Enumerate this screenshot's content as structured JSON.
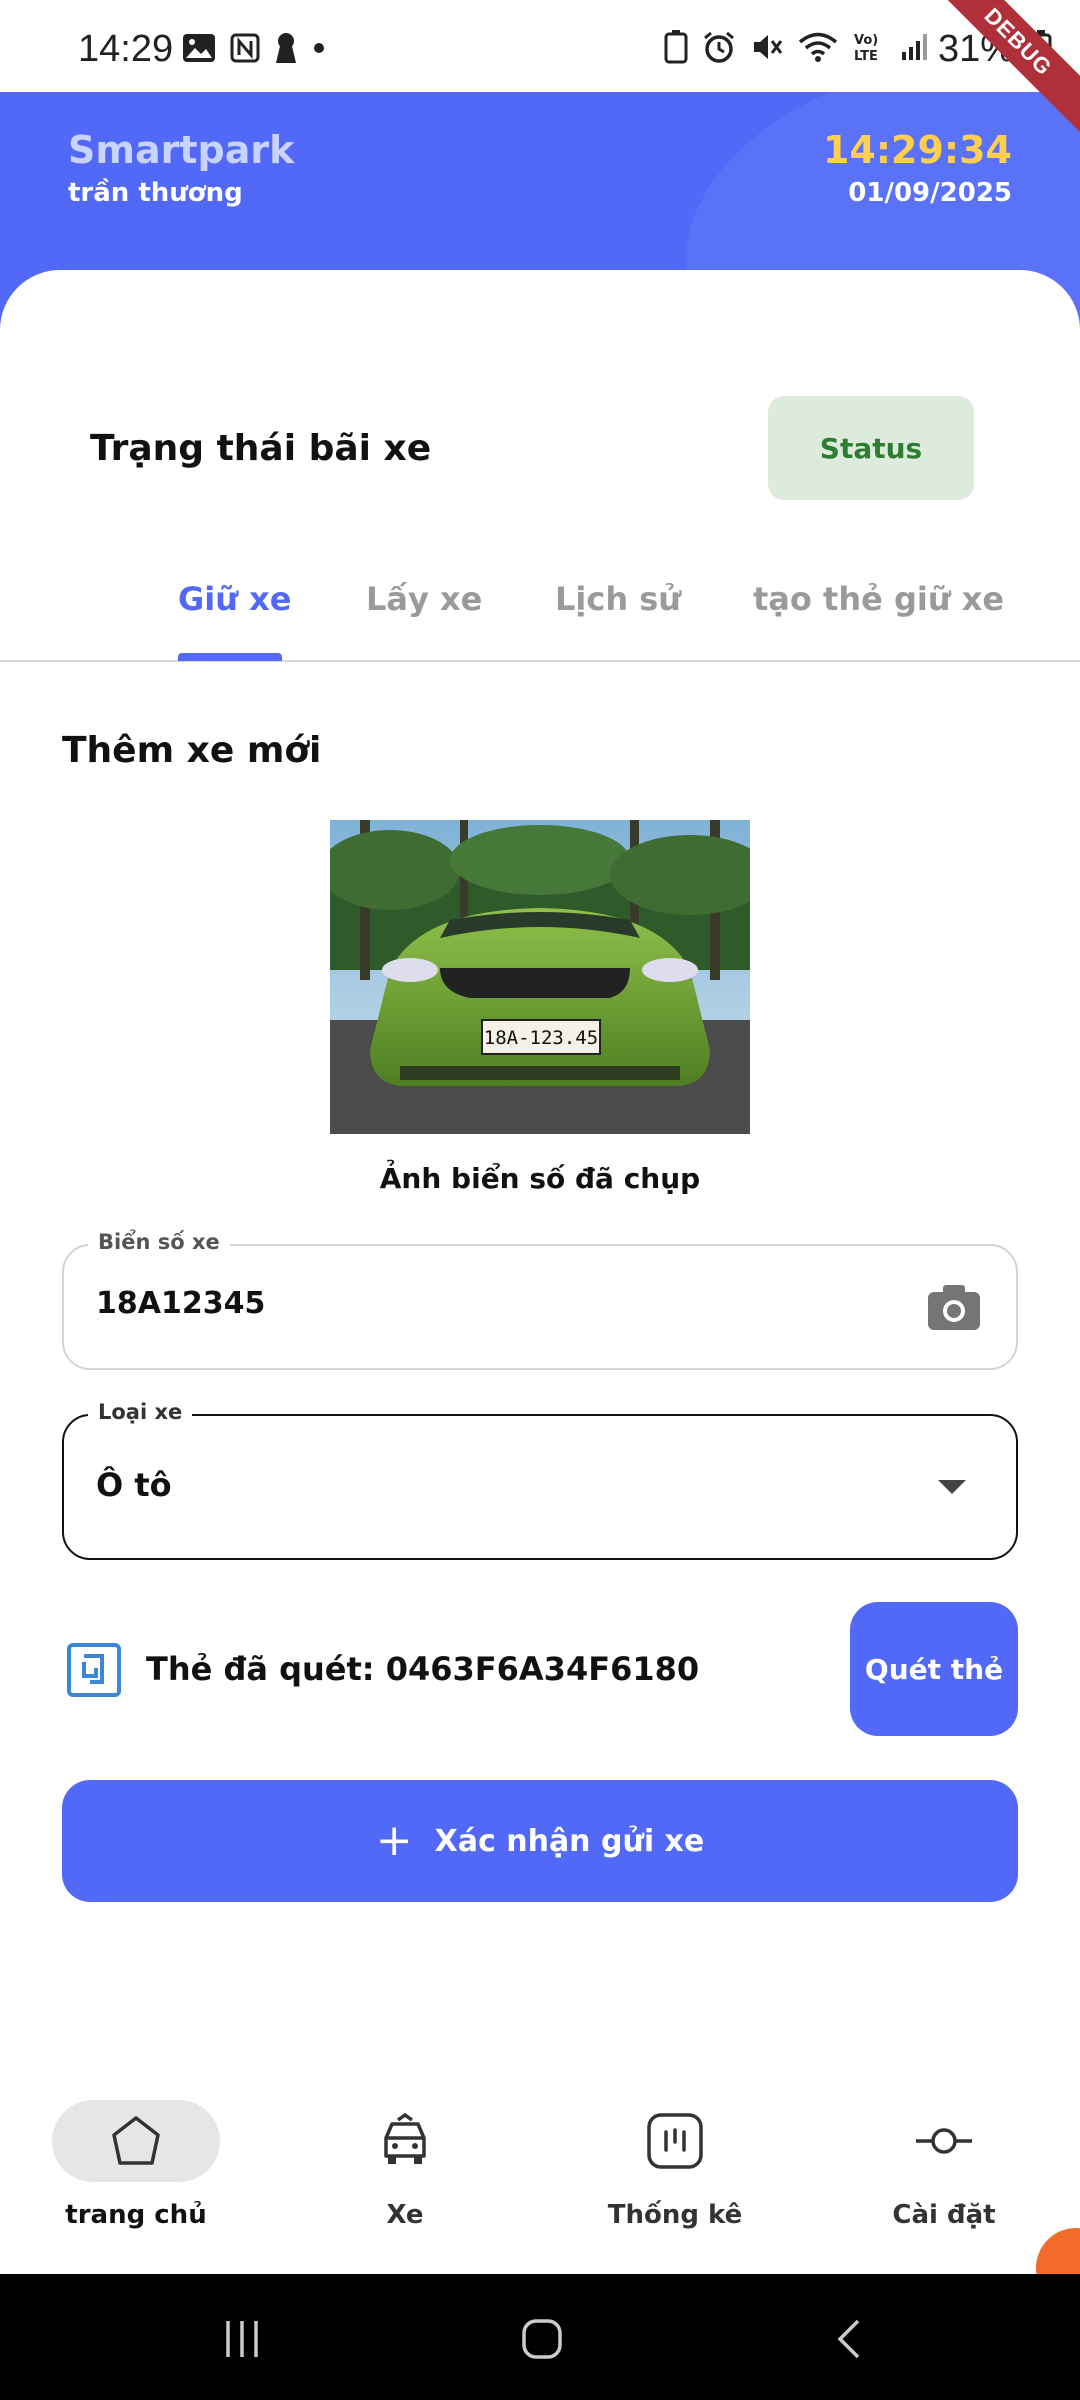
{
  "status_bar": {
    "time": "14:29",
    "battery": "31%",
    "debug_banner": "DEBUG"
  },
  "header": {
    "app_name": "Smartpark",
    "user_name": "trần thương",
    "clock": "14:29:34",
    "date": "01/09/2025"
  },
  "parking_status": {
    "title": "Trạng thái bãi xe",
    "status_label": "Status"
  },
  "tabs": [
    {
      "label": "Giữ xe",
      "active": true
    },
    {
      "label": "Lấy xe",
      "active": false
    },
    {
      "label": "Lịch sử",
      "active": false
    },
    {
      "label": "tạo thẻ giữ xe",
      "active": false
    }
  ],
  "form": {
    "section_title": "Thêm xe mới",
    "photo_caption": "Ảnh biển số đã chụp",
    "photo_plate_text": "18A-123.45",
    "plate_field": {
      "label": "Biển số xe",
      "value": "18A12345"
    },
    "type_field": {
      "label": "Loại xe",
      "value": "Ô tô"
    },
    "scanned_card": "Thẻ đã quét: 0463F6A34F6180",
    "scan_button": "Quét thẻ",
    "confirm_button": "Xác nhận gửi xe"
  },
  "bottom_nav": [
    {
      "label": "trang chủ",
      "icon": "home-icon",
      "active": true
    },
    {
      "label": "Xe",
      "icon": "car-icon",
      "active": false
    },
    {
      "label": "Thống kê",
      "icon": "stats-icon",
      "active": false
    },
    {
      "label": "Cài đặt",
      "icon": "settings-icon",
      "active": false
    }
  ],
  "colors": {
    "primary": "#5169f6",
    "clock": "#ffcf4d",
    "status_chip_bg": "#dcebdc",
    "status_chip_text": "#2f7d32"
  }
}
